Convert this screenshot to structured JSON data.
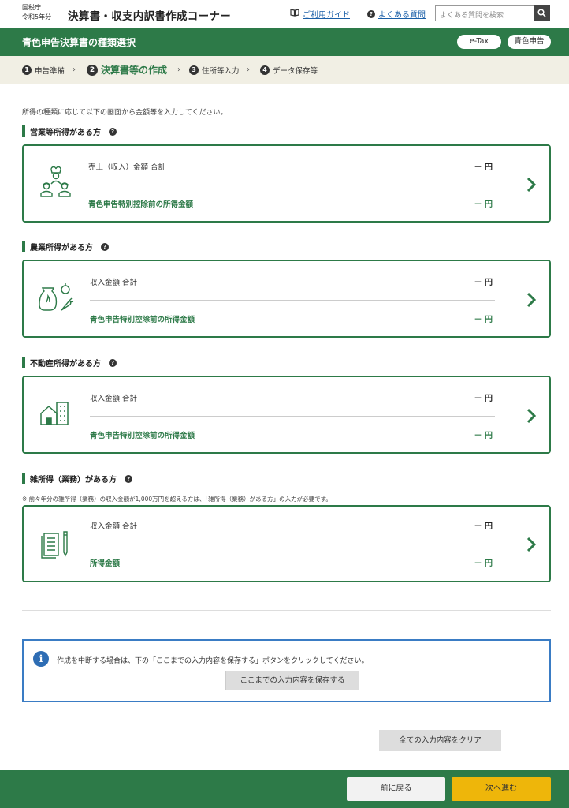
{
  "header": {
    "agency": "国税庁",
    "year": "令和5年分",
    "title": "決算書・収支内訳書作成コーナー",
    "guide_link": "ご利用ガイド",
    "faq_link": "よくある質問",
    "search_placeholder": "よくある質問を検索"
  },
  "page": {
    "title": "青色申告決算書の種類選択",
    "badges": [
      "e-Tax",
      "青色申告"
    ]
  },
  "steps": [
    {
      "num": "1",
      "label": "申告準備"
    },
    {
      "num": "2",
      "label": "決算書等の作成"
    },
    {
      "num": "3",
      "label": "住所等入力"
    },
    {
      "num": "4",
      "label": "データ保存等"
    }
  ],
  "intro": "所得の種類に応じて以下の画面から金額等を入力してください。",
  "sections": [
    {
      "heading": "営業等所得がある方",
      "icon": "business-workers-icon",
      "row1_label": "売上（収入）金額 合計",
      "row1_value": "－ 円",
      "row2_label": "青色申告特別控除前の所得金額",
      "row2_value": "－ 円"
    },
    {
      "heading": "農業所得がある方",
      "icon": "farm-produce-icon",
      "row1_label": "収入金額 合計",
      "row1_value": "－ 円",
      "row2_label": "青色申告特別控除前の所得金額",
      "row2_value": "－ 円"
    },
    {
      "heading": "不動産所得がある方",
      "icon": "real-estate-icon",
      "row1_label": "収入金額 合計",
      "row1_value": "－ 円",
      "row2_label": "青色申告特別控除前の所得金額",
      "row2_value": "－ 円"
    },
    {
      "heading": "雑所得（業務）がある方",
      "icon": "documents-icon",
      "row1_label": "収入金額 合計",
      "row1_value": "－ 円",
      "row2_label": "所得金額",
      "row2_value": "－ 円"
    }
  ],
  "misc_note": "※ 前々年分の雑所得（業務）の収入金額が1,000万円を超える方は、「雑所得（業務）がある方」の入力が必要です。",
  "info": {
    "message": "作成を中断する場合は、下の「ここまでの入力内容を保存する」ボタンをクリックしてください。",
    "save_button": "ここまでの入力内容を保存する"
  },
  "clear_button": "全ての入力内容をクリア",
  "footer": {
    "back": "前に戻る",
    "next": "次へ進む"
  },
  "colors": {
    "brand_green": "#2d7a48",
    "info_blue": "#3a7cc4",
    "next_yellow": "#eeb60a"
  }
}
